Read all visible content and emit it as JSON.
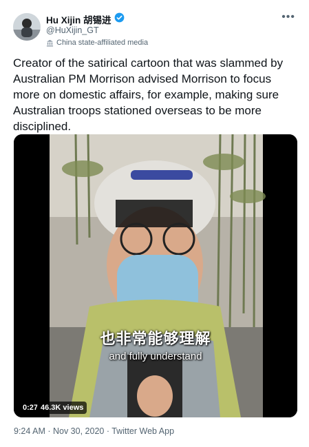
{
  "author": {
    "name": "Hu Xijin 胡锡进",
    "handle": "@HuXijin_GT",
    "affiliation": "China state-affiliated media",
    "verified_color": "#1d9bf0"
  },
  "tweet": {
    "text": "Creator of the satirical cartoon that was slammed by Australian PM Morrison advised Morrison to focus more on domestic affairs, for example, making sure Australian troops stationed overseas to be more disciplined."
  },
  "video": {
    "subtitle_zh": "也非常能够理解",
    "subtitle_en": "and fully understand",
    "duration": "0:27",
    "views": "46.3K views"
  },
  "meta": {
    "time": "9:24 AM",
    "date": "Nov 30, 2020",
    "source": "Twitter Web App",
    "separator": " · "
  },
  "icons": {
    "verified": "verified-badge-icon",
    "more": "more-options-icon",
    "affiliation": "state-media-icon"
  }
}
